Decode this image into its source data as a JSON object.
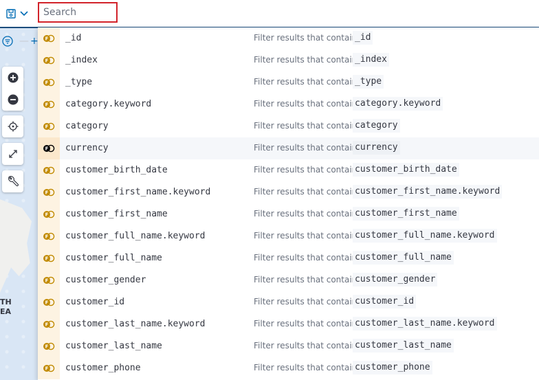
{
  "search": {
    "placeholder": "Search"
  },
  "map": {
    "label_line1": "TH",
    "label_line2": "EA"
  },
  "suggestion_prefix": "Filter results that contain",
  "colors": {
    "accent": "#006bb4",
    "search_border": "#d2232a",
    "type_bg": "#fdf3e2",
    "type_icon": "#c18a00"
  },
  "suggestions": [
    {
      "field": "_id",
      "highlight": false
    },
    {
      "field": "_index",
      "highlight": false
    },
    {
      "field": "_type",
      "highlight": false
    },
    {
      "field": "category.keyword",
      "highlight": false
    },
    {
      "field": "category",
      "highlight": false
    },
    {
      "field": "currency",
      "highlight": true
    },
    {
      "field": "customer_birth_date",
      "highlight": false
    },
    {
      "field": "customer_first_name.keyword",
      "highlight": false
    },
    {
      "field": "customer_first_name",
      "highlight": false
    },
    {
      "field": "customer_full_name.keyword",
      "highlight": false
    },
    {
      "field": "customer_full_name",
      "highlight": false
    },
    {
      "field": "customer_gender",
      "highlight": false
    },
    {
      "field": "customer_id",
      "highlight": false
    },
    {
      "field": "customer_last_name.keyword",
      "highlight": false
    },
    {
      "field": "customer_last_name",
      "highlight": false
    },
    {
      "field": "customer_phone",
      "highlight": false
    }
  ]
}
